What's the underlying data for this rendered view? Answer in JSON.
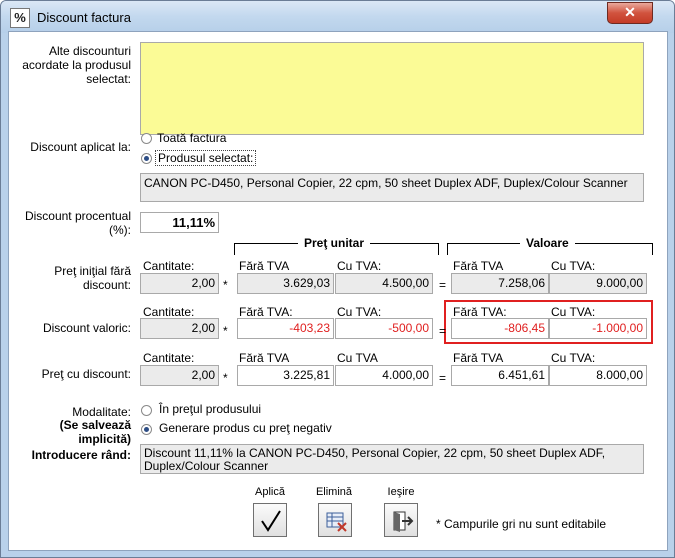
{
  "window": {
    "title": "Discount factura",
    "icon_glyph": "%",
    "close_glyph": "✕"
  },
  "other_discounts": {
    "label": "Alte discounturi acordate la produsul selectat:",
    "value": ""
  },
  "apply_to": {
    "label": "Discount aplicat la:",
    "options": [
      "Toată factura",
      "Produsul selectat:"
    ],
    "selected": "Produsul selectat:"
  },
  "product_name": "CANON PC-D450, Personal Copier, 22 cpm, 50 sheet Duplex ADF, Duplex/Colour Scanner",
  "percent": {
    "label": "Discount procentual (%):",
    "value": "11,11%"
  },
  "headers": {
    "unit_price": "Preţ unitar",
    "value": "Valoare"
  },
  "sublabels": {
    "quantity": "Cantitate:",
    "without_vat": "Fără TVA",
    "without_vat_colon": "Fără TVA:",
    "with_vat": "Cu TVA:",
    "with_vat_plain": "Cu TVA"
  },
  "operators": {
    "times": "*",
    "equals": "="
  },
  "rows": {
    "initial": {
      "label": "Preţ iniţial fără discount:",
      "quantity": "2,00",
      "unit_no_vat": "3.629,03",
      "unit_vat": "4.500,00",
      "value_no_vat": "7.258,06",
      "value_vat": "9.000,00"
    },
    "discount": {
      "label": "Discount valoric:",
      "quantity": "2,00",
      "unit_no_vat": "-403,23",
      "unit_vat": "-500,00",
      "value_no_vat": "-806,45",
      "value_vat": "-1.000,00"
    },
    "final": {
      "label": "Preţ cu discount:",
      "quantity": "2,00",
      "unit_no_vat": "3.225,81",
      "unit_vat": "4.000,00",
      "value_no_vat": "6.451,61",
      "value_vat": "8.000,00"
    }
  },
  "mode": {
    "label_line1": "Modalitate:",
    "label_line2": "(Se salvează implicită)",
    "options": [
      "În preţul produsului",
      "Generare produs cu preţ negativ"
    ],
    "selected": "Generare produs cu preţ negativ"
  },
  "row_entry": {
    "label": "Introducere rând:",
    "value": "Discount 11,11% la CANON PC-D450, Personal Copier, 22 cpm, 50 sheet Duplex ADF, Duplex/Colour Scanner"
  },
  "buttons": {
    "apply": "Aplică",
    "delete": "Elimină",
    "exit": "Ieşire"
  },
  "note": "* Campurile gri nu sunt editabile",
  "colors": {
    "highlight_border": "#e02020",
    "negative_text": "#e02020",
    "yellow_field": "#fbfb96",
    "readonly_field": "#ebebeb"
  }
}
